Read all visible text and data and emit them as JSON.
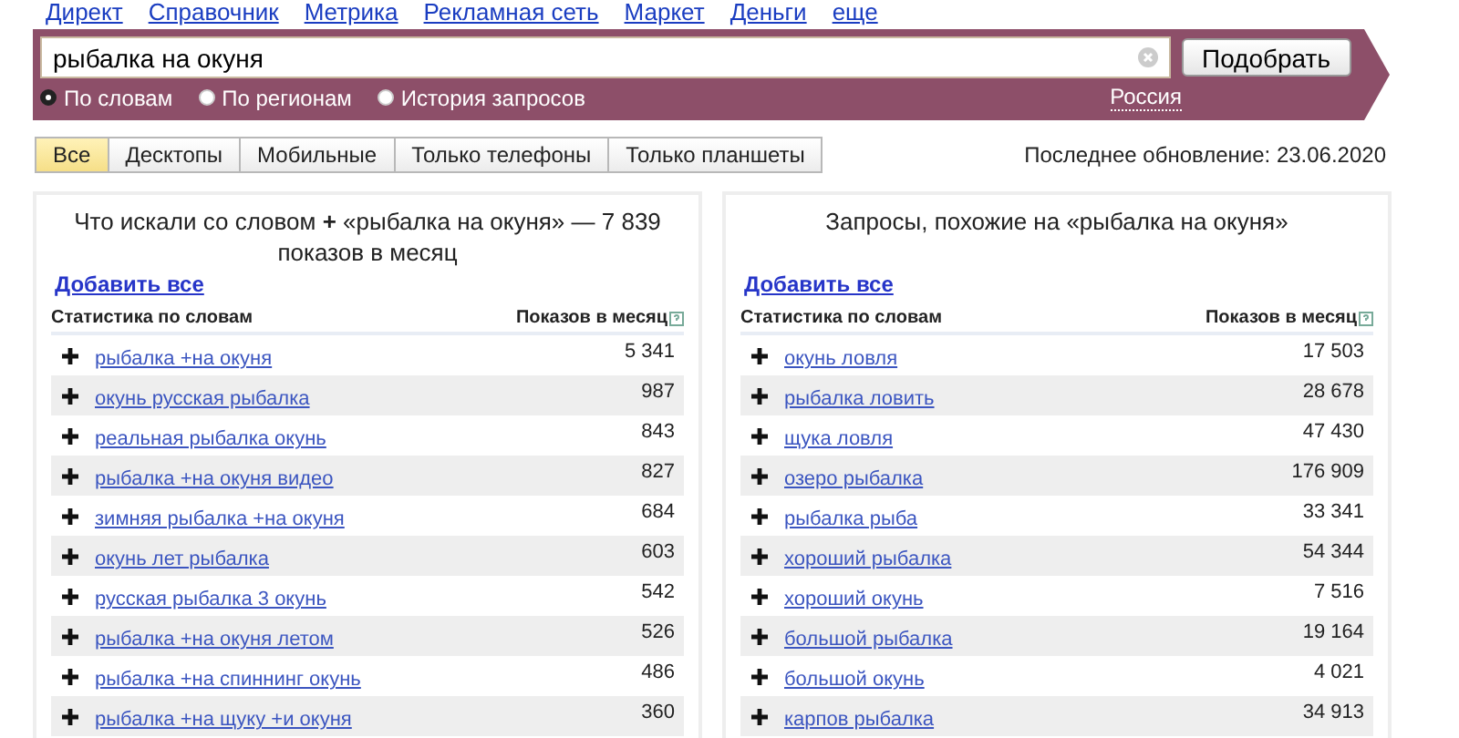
{
  "nav": [
    "Директ",
    "Справочник",
    "Метрика",
    "Рекламная сеть",
    "Маркет",
    "Деньги",
    "еще"
  ],
  "search": {
    "value": "рыбалка на окуня",
    "button": "Подобрать",
    "region": "Россия",
    "modes": [
      {
        "label": "По словам",
        "selected": true
      },
      {
        "label": "По регионам",
        "selected": false
      },
      {
        "label": "История запросов",
        "selected": false
      }
    ]
  },
  "tabs": [
    {
      "label": "Все",
      "selected": true
    },
    {
      "label": "Десктопы",
      "selected": false
    },
    {
      "label": "Мобильные",
      "selected": false
    },
    {
      "label": "Только телефоны",
      "selected": false
    },
    {
      "label": "Только планшеты",
      "selected": false
    }
  ],
  "last_update": "Последнее обновление: 23.06.2020",
  "panels": [
    {
      "title": "Что искали со словом **+** «рыбалка на окуня» — 7 839 показов в месяц",
      "add_all": "Добавить все",
      "col_words": "Статистика по словам",
      "col_count": "Показов в месяц",
      "rows": [
        {
          "phrase": "рыбалка +на окуня",
          "count": "5 341"
        },
        {
          "phrase": "окунь русская рыбалка",
          "count": "987"
        },
        {
          "phrase": "реальная рыбалка окунь",
          "count": "843"
        },
        {
          "phrase": "рыбалка +на окуня видео",
          "count": "827"
        },
        {
          "phrase": "зимняя рыбалка +на окуня",
          "count": "684"
        },
        {
          "phrase": "окунь лет рыбалка",
          "count": "603"
        },
        {
          "phrase": "русская рыбалка 3 окунь",
          "count": "542"
        },
        {
          "phrase": "рыбалка +на окуня летом",
          "count": "526"
        },
        {
          "phrase": "рыбалка +на спиннинг окунь",
          "count": "486"
        },
        {
          "phrase": "рыбалка +на щуку +и окуня",
          "count": "360"
        }
      ]
    },
    {
      "title": "Запросы, похожие на «рыбалка на окуня»",
      "add_all": "Добавить все",
      "col_words": "Статистика по словам",
      "col_count": "Показов в месяц",
      "rows": [
        {
          "phrase": "окунь ловля",
          "count": "17 503"
        },
        {
          "phrase": "рыбалка ловить",
          "count": "28 678"
        },
        {
          "phrase": "щука ловля",
          "count": "47 430"
        },
        {
          "phrase": "озеро рыбалка",
          "count": "176 909"
        },
        {
          "phrase": "рыбалка рыба",
          "count": "33 341"
        },
        {
          "phrase": "хороший рыбалка",
          "count": "54 344"
        },
        {
          "phrase": "хороший окунь",
          "count": "7 516"
        },
        {
          "phrase": "большой рыбалка",
          "count": "19 164"
        },
        {
          "phrase": "большой окунь",
          "count": "4 021"
        },
        {
          "phrase": "карпов рыбалка",
          "count": "34 913"
        }
      ]
    }
  ]
}
